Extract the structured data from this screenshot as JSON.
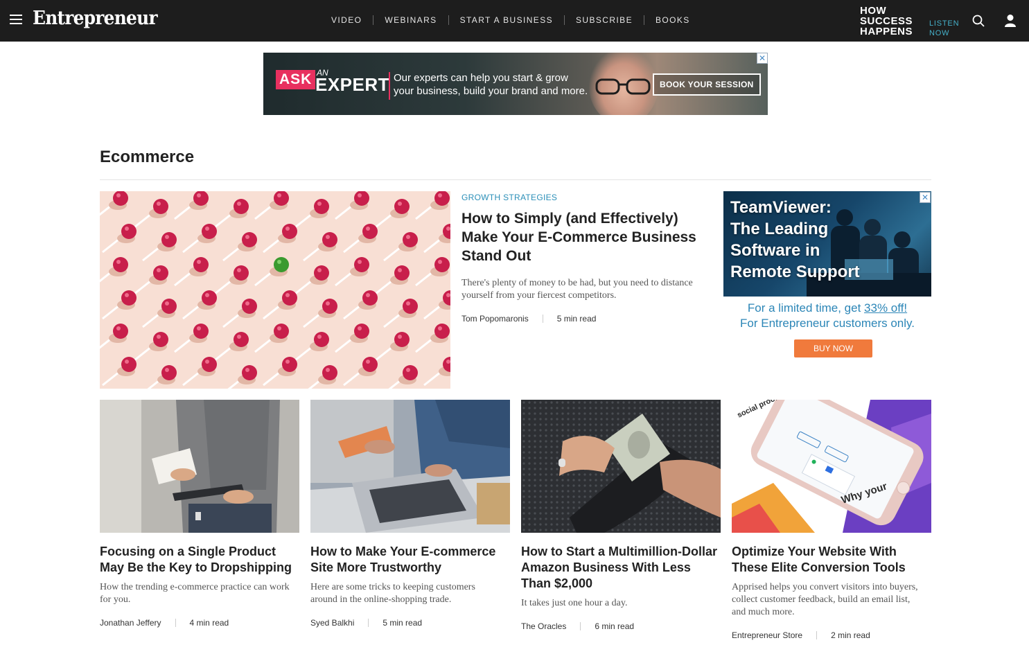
{
  "header": {
    "logo": "Entrepreneur",
    "nav": [
      "VIDEO",
      "WEBINARS",
      "START A BUSINESS",
      "SUBSCRIBE",
      "BOOKS"
    ],
    "podcast": {
      "line1": "HOW",
      "line2": "SUCCESS",
      "line3": "HAPPENS",
      "listen1": "LISTEN",
      "listen2": "NOW"
    }
  },
  "banner_ad": {
    "ask": "ASK",
    "an": "AN",
    "expert": "EXPERT",
    "copy_line1": "Our experts can help you start & grow",
    "copy_line2": "your business, build your brand and more.",
    "cta": "BOOK YOUR SESSION",
    "close": "✕"
  },
  "section": {
    "title": "Ecommerce"
  },
  "featured": {
    "category": "GROWTH STRATEGIES",
    "title": "How to Simply (and Effectively) Make Your E-Commerce Business Stand Out",
    "description": "There's plenty of money to be had, but you need to distance yourself from your fiercest competitors.",
    "author": "Tom Popomaronis",
    "read_time": "5 min read"
  },
  "side_ad": {
    "headline_line1": "TeamViewer:",
    "headline_line2": "The Leading",
    "headline_line3": "Software in",
    "headline_line4": "Remote Support",
    "promo_prefix": "For a limited time, get ",
    "promo_link": "33% off!",
    "promo_line2": "For Entrepreneur customers only.",
    "cta": "BUY NOW",
    "close": "✕"
  },
  "cards": [
    {
      "title": "Focusing on a Single Product May Be the Key to Dropshipping",
      "description": "How the trending e-commerce practice can work for you.",
      "author": "Jonathan Jeffery",
      "read_time": "4 min read"
    },
    {
      "title": "How to Make Your E-commerce Site More Trustworthy",
      "description": "Here are some tricks to keeping customers around in the online-shopping trade.",
      "author": "Syed Balkhi",
      "read_time": "5 min read"
    },
    {
      "title": "How to Start a Multimillion-Dollar Amazon Business With Less Than $2,000",
      "description": "It takes just one hour a day.",
      "author": "The Oracles",
      "read_time": "6 min read"
    },
    {
      "title": "Optimize Your Website With These Elite Conversion Tools",
      "description": "Apprised helps you convert visitors into buyers, collect customer feedback, build an email list, and much more.",
      "author": "Entrepreneur Store",
      "read_time": "2 min read",
      "image_text_1": "Why your",
      "image_text_2": "social proof"
    }
  ]
}
